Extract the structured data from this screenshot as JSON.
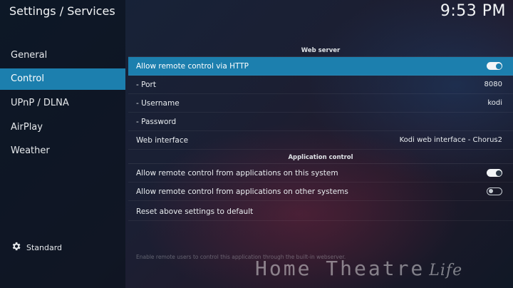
{
  "header": {
    "title": "Settings / Services",
    "clock": "9:53 PM"
  },
  "sidebar": {
    "items": [
      {
        "label": "General",
        "active": false
      },
      {
        "label": "Control",
        "active": true
      },
      {
        "label": "UPnP / DLNA",
        "active": false
      },
      {
        "label": "AirPlay",
        "active": false
      },
      {
        "label": "Weather",
        "active": false
      }
    ],
    "level_label": "Standard",
    "level_icon": "gear-icon"
  },
  "sections": {
    "web_server": "Web server",
    "app_control": "Application control"
  },
  "settings": {
    "http_remote": {
      "label": "Allow remote control via HTTP",
      "enabled": true
    },
    "port": {
      "label": "- Port",
      "value": "8080"
    },
    "username": {
      "label": "- Username",
      "value": "kodi"
    },
    "password": {
      "label": "- Password",
      "value": ""
    },
    "web_interface": {
      "label": "Web interface",
      "value": "Kodi web interface - Chorus2"
    },
    "local_apps": {
      "label": "Allow remote control from applications on this system",
      "enabled": true
    },
    "remote_apps": {
      "label": "Allow remote control from applications on other systems",
      "enabled": false
    },
    "reset": {
      "label": "Reset above settings to default"
    }
  },
  "footer": {
    "description": "Enable remote users to control this application through the built-in webserver."
  },
  "watermark": {
    "text": "Home Theatre",
    "suffix": "Life"
  },
  "colors": {
    "accent": "#1c7fae"
  }
}
